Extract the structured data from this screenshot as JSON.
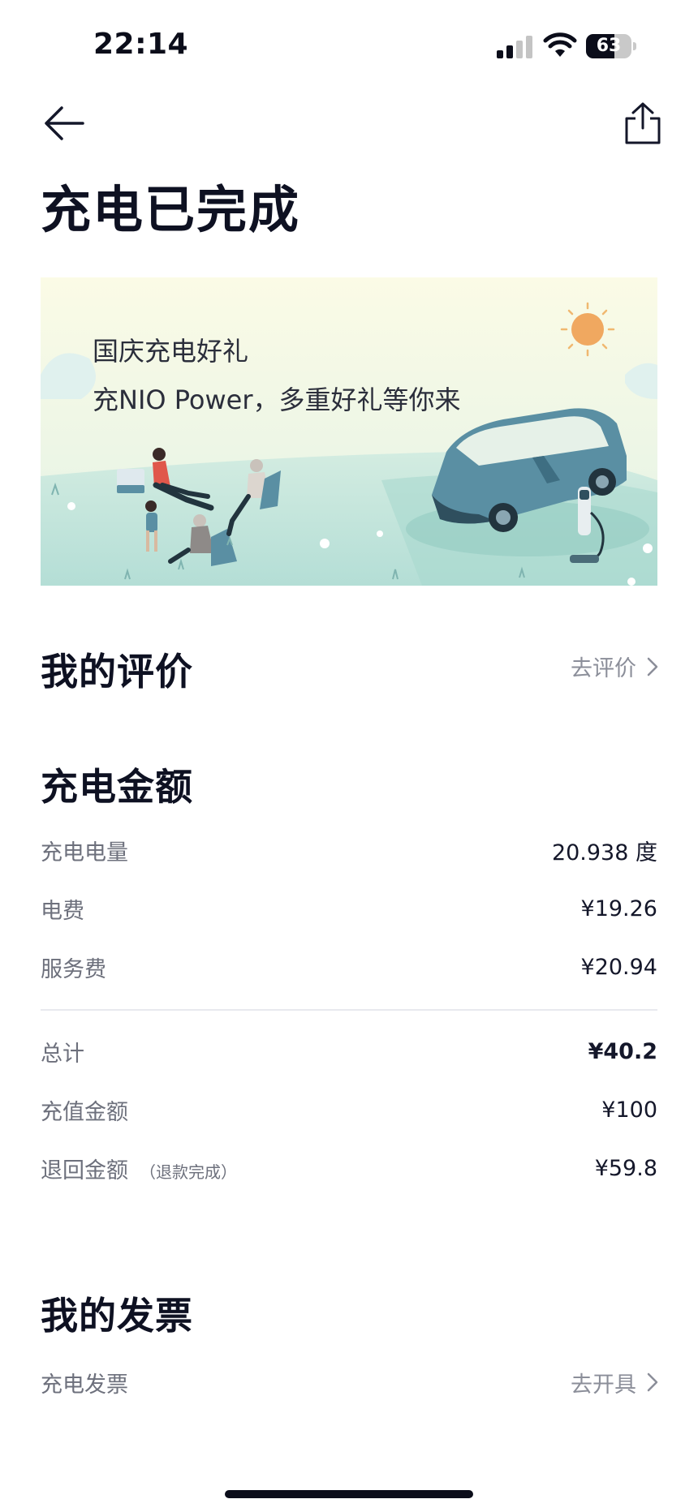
{
  "status_bar": {
    "time": "22:14",
    "battery_level": "63",
    "battery_fraction": 0.63
  },
  "nav": {
    "back_icon": "arrow-left-icon",
    "share_icon": "share-icon"
  },
  "page_title": "充电已完成",
  "banner": {
    "line1": "国庆充电好礼",
    "line2": "充NIO Power，多重好礼等你来"
  },
  "review": {
    "title": "我的评价",
    "action": "去评价"
  },
  "charge_amount": {
    "title": "充电金额",
    "rows": [
      {
        "label": "充电电量",
        "value": "20.938 度"
      },
      {
        "label": "电费",
        "value": "¥19.26"
      },
      {
        "label": "服务费",
        "value": "¥20.94"
      }
    ],
    "summary": [
      {
        "label": "总计",
        "value": "¥40.2"
      },
      {
        "label": "充值金额",
        "value": "¥100"
      },
      {
        "label": "退回金额",
        "note": "（退款完成）",
        "value": "¥59.8"
      }
    ]
  },
  "invoice": {
    "title": "我的发票",
    "row_label": "充电发票",
    "action": "去开具"
  },
  "colors": {
    "text_primary": "#0e1122",
    "text_secondary": "#6d707c",
    "link_gray": "#8b8e99",
    "banner_sky": "#f6f8dc",
    "banner_ground": "#c7e8e0",
    "car_body": "#5a8fa3",
    "sun": "#f0a860"
  }
}
